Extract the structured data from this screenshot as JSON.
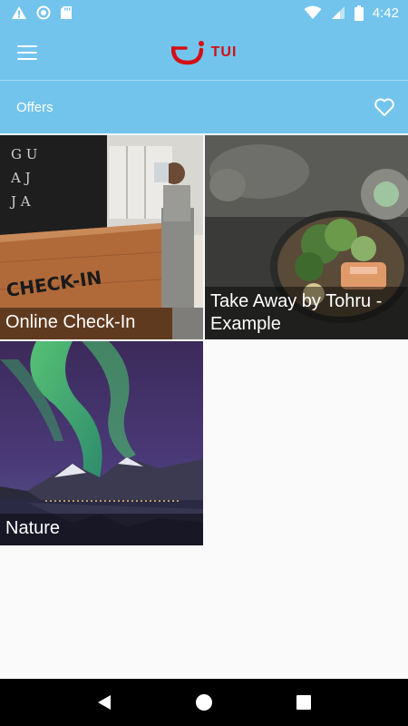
{
  "status_bar": {
    "time": "4:42",
    "icons": [
      "warning-icon",
      "data-saver-icon",
      "sd-card-icon",
      "wifi-icon",
      "signal-icon",
      "battery-icon"
    ]
  },
  "app_bar": {
    "logo_text": "TUI",
    "menu_icon": "hamburger-menu-icon"
  },
  "sub_bar": {
    "title": "Offers",
    "favorite_icon": "heart-outline-icon"
  },
  "offers": [
    {
      "caption": "Online Check-In",
      "image": "hotel-check-in-desk-photo"
    },
    {
      "caption": "Take Away by Tohru - Example",
      "image": "food-bowl-photo"
    },
    {
      "caption": "Nature",
      "image": "northern-lights-photo"
    }
  ],
  "nav_bar": {
    "icons": [
      "back-icon",
      "home-icon",
      "recents-icon"
    ]
  },
  "colors": {
    "primary": "#72c4ec",
    "logo_red": "#d40e14",
    "background": "#fafafa"
  }
}
